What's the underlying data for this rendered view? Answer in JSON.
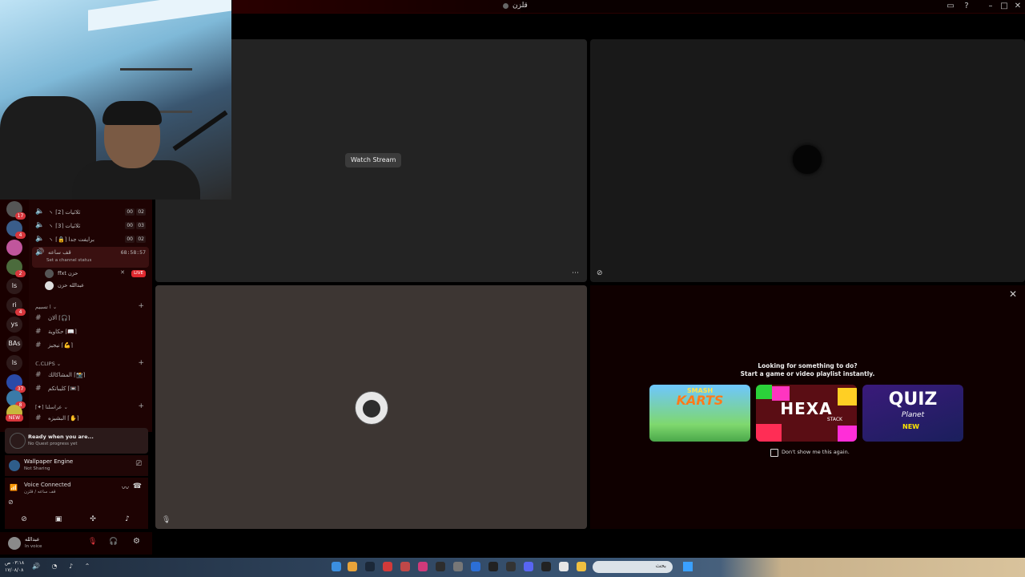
{
  "window": {
    "title": "قلزن"
  },
  "servers": [
    {
      "label": "",
      "badge": "17"
    },
    {
      "label": "",
      "badge": "4"
    },
    {
      "label": "",
      "badge": ""
    },
    {
      "label": "",
      "badge": "2"
    },
    {
      "label": "ls",
      "badge": ""
    },
    {
      "label": "ri",
      "badge": "4"
    },
    {
      "label": "ys",
      "badge": ""
    },
    {
      "label": "BAs",
      "badge": ""
    },
    {
      "label": "ls",
      "badge": ""
    },
    {
      "label": "",
      "badge": "37"
    },
    {
      "label": "",
      "badge": "8"
    },
    {
      "label": "",
      "badge": ""
    }
  ],
  "servers_new_badge": "NEW",
  "channels": {
    "voice": [
      {
        "name": "ثلاثيات ⌈2⌉ ヽ",
        "count_a": "00",
        "count_b": "02"
      },
      {
        "name": "ثلاثيات ⌈3⌉ ヽ",
        "count_a": "00",
        "count_b": "03"
      },
      {
        "name": "برايفت جدا ⌈🔒⌉ ヽ",
        "count_a": "00",
        "count_b": "02"
      }
    ],
    "active": {
      "name": "قف ساعه",
      "timer": "68:58:57",
      "status_hint": "Set a channel status"
    },
    "voice_users": [
      {
        "name": "ffxt",
        "tag": "حزن",
        "live": "LIVE"
      },
      {
        "name": "عبدالله",
        "tag": "حزن",
        "live": ""
      }
    ],
    "category_1": "ا تسبيم",
    "text_1": [
      {
        "name": "⌈🎧⌉ ألان"
      },
      {
        "name": "⌈📖⌉ حكاوية"
      },
      {
        "name": "⌈💪⌉ نيجيز"
      }
    ],
    "category_2": "ℂ.CLIPS",
    "text_2": [
      {
        "name": "⌈📸⌉ المشاكالك"
      },
      {
        "name": "⌈📼⌉ كليباتكم"
      }
    ],
    "category_3": "⌈✦⌉ عراسلنا",
    "text_3": [
      {
        "name": "⌈✋⌉ البشيزه"
      }
    ]
  },
  "quest": {
    "title": "Ready when you are...",
    "subtitle": "No Quest progress yet"
  },
  "activity_app": {
    "title": "Wallpaper Engine",
    "subtitle": "Not Sharing"
  },
  "voice": {
    "title": "Voice Connected",
    "subtitle": "قف ساعه / قلزن"
  },
  "user": {
    "name": "عبدالله",
    "status": "In voice"
  },
  "tiles": {
    "watch_stream_label": "Watch Stream"
  },
  "activities": {
    "prompt_line1": "Looking for something to do?",
    "prompt_line2": "Start a game or video playlist instantly.",
    "games": [
      {
        "name_top": "SMASH",
        "name_main": "KARTS"
      },
      {
        "name_main": "HEXA",
        "name_sub": "STACK"
      },
      {
        "name_main": "QUIZ",
        "name_sub": "Planet",
        "badge": "NEW"
      }
    ],
    "dont_show": "Don't show me this again."
  },
  "taskbar": {
    "time": "٠٣:١٨ ص",
    "date": "١٧/٠٨/٠٨",
    "search_placeholder": "بحث"
  }
}
